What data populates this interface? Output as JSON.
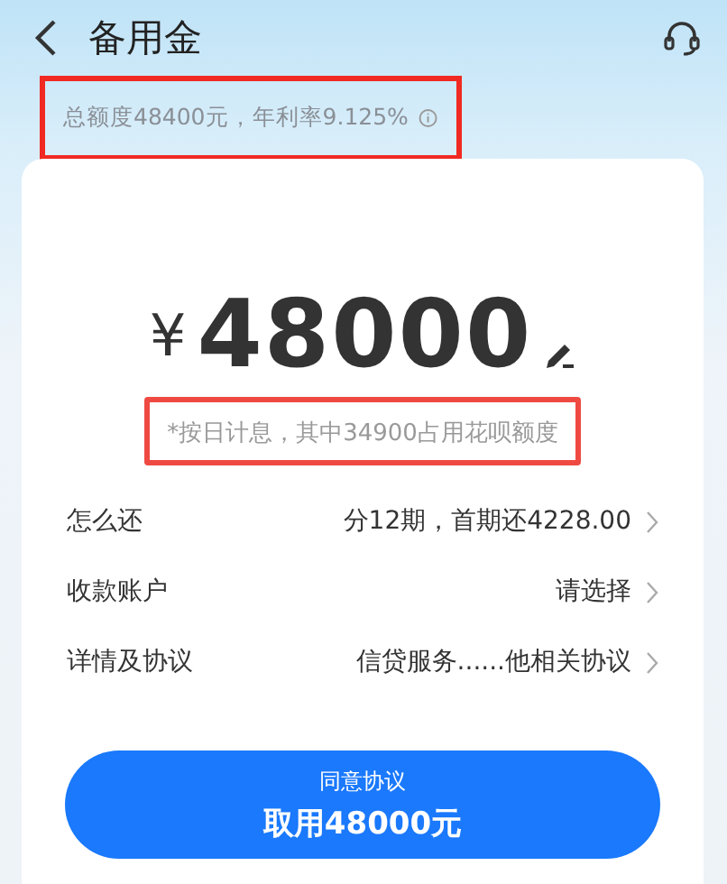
{
  "header": {
    "title": "备用金",
    "subtitle": {
      "text": "总额度48400元，年利率9.125%",
      "highlighted": true
    }
  },
  "amount": {
    "currency": "¥",
    "value": "48000",
    "note": {
      "text": "*按日计息，其中34900占用花呗额度",
      "highlighted": true
    }
  },
  "rows": [
    {
      "label": "怎么还",
      "value": "分12期，首期还4228.00"
    },
    {
      "label": "收款账户",
      "value": "请选择"
    },
    {
      "label": "详情及协议",
      "value": "信贷服务......他相关协议"
    }
  ],
  "button": {
    "caption": "同意协议",
    "label": "取用48000元"
  }
}
